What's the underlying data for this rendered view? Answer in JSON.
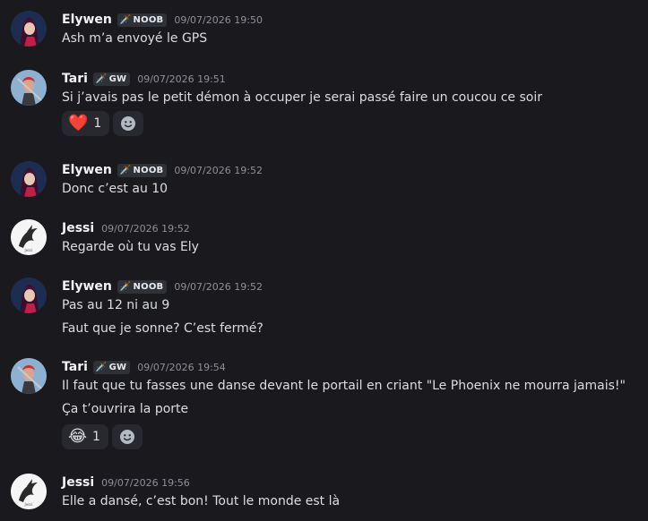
{
  "tags": {
    "noob": "NOOB",
    "gw": "GW"
  },
  "messages": [
    {
      "author": "Elywen",
      "tag": "NOOB",
      "time": "09/07/2026 19:50",
      "lines": [
        "Ash m’a envoyé le GPS"
      ]
    },
    {
      "author": "Tari",
      "tag": "GW",
      "time": "09/07/2026 19:51",
      "lines": [
        "Si j’avais pas le petit démon à occuper je serai passé faire un coucou ce soir"
      ],
      "reaction": {
        "emoji": "❤️",
        "count": "1"
      }
    },
    {
      "author": "Elywen",
      "tag": "NOOB",
      "time": "09/07/2026 19:52",
      "lines": [
        "Donc c’est au 10"
      ]
    },
    {
      "author": "Jessi",
      "time": "09/07/2026 19:52",
      "lines": [
        "Regarde où tu vas Ely"
      ]
    },
    {
      "author": "Elywen",
      "tag": "NOOB",
      "time": "09/07/2026 19:52",
      "lines": [
        "Pas au 12 ni au 9",
        "Faut que je sonne? C’est fermé?"
      ]
    },
    {
      "author": "Tari",
      "tag": "GW",
      "time": "09/07/2026 19:54",
      "lines": [
        "Il faut que tu fasses une danse devant le portail en criant \"Le Phoenix ne mourra jamais!\"",
        "Ça t’ouvrira la porte"
      ],
      "reaction": {
        "emoji": "😂",
        "count": "1"
      }
    },
    {
      "author": "Jessi",
      "time": "09/07/2026 19:56",
      "lines": [
        "Elle a dansé, c’est bon! Tout le monde est là"
      ]
    }
  ]
}
